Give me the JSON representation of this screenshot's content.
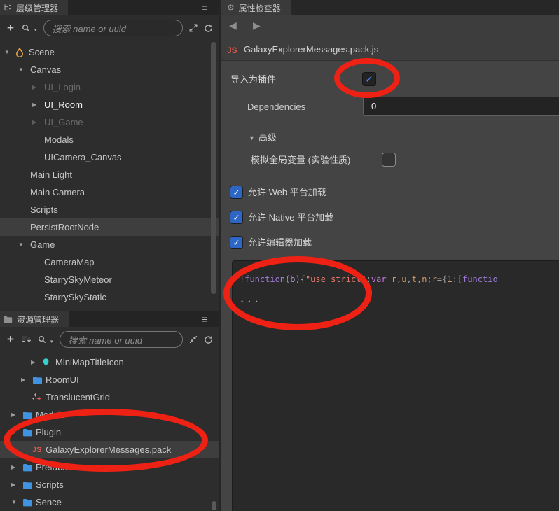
{
  "colors": {
    "annotation_red": "#ed2215",
    "accent_blue": "#2d66c5",
    "folder_blue": "#3f93e0",
    "js_red": "#e0584c",
    "prefab_teal": "#35d0ce",
    "scene_orange": "#e8a13e"
  },
  "icons": {
    "menu": "≡",
    "gear": "⚙",
    "back": "◀",
    "forward": "▶",
    "plus": "+",
    "check": "✓",
    "section_open": "▼",
    "search_caret": "▾"
  },
  "hierarchy_panel": {
    "tab_label": "层级管理器",
    "search_placeholder": "搜索 name or uuid",
    "tree": [
      {
        "label": "Scene",
        "depth": 0,
        "arrow": "open",
        "icon": "scene"
      },
      {
        "label": "Canvas",
        "depth": 1,
        "arrow": "open"
      },
      {
        "label": "UI_Login",
        "depth": 2,
        "arrow": "closed",
        "state": "dim"
      },
      {
        "label": "UI_Room",
        "depth": 2,
        "arrow": "closed",
        "state": "bright"
      },
      {
        "label": "UI_Game",
        "depth": 2,
        "arrow": "closed",
        "state": "dim"
      },
      {
        "label": "Modals",
        "depth": 2
      },
      {
        "label": "UICamera_Canvas",
        "depth": 2
      },
      {
        "label": "Main Light",
        "depth": 1
      },
      {
        "label": "Main Camera",
        "depth": 1
      },
      {
        "label": "Scripts",
        "depth": 1
      },
      {
        "label": "PersistRootNode",
        "depth": 1,
        "state": "selected"
      },
      {
        "label": "Game",
        "depth": 1,
        "arrow": "open"
      },
      {
        "label": "CameraMap",
        "depth": 2
      },
      {
        "label": "StarrySkyMeteor",
        "depth": 2
      },
      {
        "label": "StarrySkyStatic",
        "depth": 2
      }
    ]
  },
  "assets_panel": {
    "tab_label": "资源管理器",
    "search_placeholder": "搜索 name or uuid",
    "tree": [
      {
        "label": "MiniMapTitleIcon",
        "depth": 3,
        "arrow": "closed",
        "icon": "prefab"
      },
      {
        "label": "RoomUI",
        "depth": 2,
        "arrow": "closed",
        "icon": "folder"
      },
      {
        "label": "TranslucentGrid",
        "depth": 2,
        "icon": "sparkle"
      },
      {
        "label": "Models",
        "depth": 1,
        "arrow": "closed",
        "icon": "folder"
      },
      {
        "label": "Plugin",
        "depth": 1,
        "arrow": "open",
        "icon": "folder"
      },
      {
        "label": "GalaxyExplorerMessages.pack",
        "depth": 2,
        "icon": "js",
        "state": "selected"
      },
      {
        "label": "Prefabs",
        "depth": 1,
        "arrow": "closed",
        "icon": "folder"
      },
      {
        "label": "Scripts",
        "depth": 1,
        "arrow": "closed",
        "icon": "folder"
      },
      {
        "label": "Sence",
        "depth": 1,
        "arrow": "open",
        "icon": "folder"
      }
    ]
  },
  "inspector": {
    "tab_label": "属性检查器",
    "js_badge": "JS",
    "file_title": "GalaxyExplorerMessages.pack.js",
    "properties": {
      "import_as_plugin_label": "导入为插件",
      "dependencies_label": "Dependencies",
      "dependencies_value": "0",
      "advanced_label": "高级",
      "simulate_globals_label": "模拟全局变量 (实验性质)",
      "allow_web_label": "允许 Web 平台加载",
      "allow_native_label": "允许 Native 平台加载",
      "allow_editor_label": "允许编辑器加载"
    },
    "checkbox_states": {
      "import_as_plugin": true,
      "simulate_globals": false,
      "allow_web": true,
      "allow_native": true,
      "allow_editor": true
    },
    "code_preview": {
      "ellipsis_line": "...",
      "tokens": [
        {
          "text": "!",
          "color": "#e06c6c"
        },
        {
          "text": "function",
          "color": "#9d7bd8"
        },
        {
          "text": "(b)",
          "color": "#b48fd9"
        },
        {
          "text": "{",
          "color": "#9aa0a8"
        },
        {
          "text": "\"use strict\"",
          "color": "#e8796c"
        },
        {
          "text": ";",
          "color": "#9aa0a8"
        },
        {
          "text": "var",
          "color": "#c678dd"
        },
        {
          "text": " ",
          "color": "#9aa0a8"
        },
        {
          "text": "r",
          "color": "#d19a66"
        },
        {
          "text": ",",
          "color": "#9aa0a8"
        },
        {
          "text": "u",
          "color": "#d19a66"
        },
        {
          "text": ",",
          "color": "#9aa0a8"
        },
        {
          "text": "t",
          "color": "#d19a66"
        },
        {
          "text": ",",
          "color": "#9aa0a8"
        },
        {
          "text": "n",
          "color": "#d19a66"
        },
        {
          "text": ";",
          "color": "#9aa0a8"
        },
        {
          "text": "r",
          "color": "#d19a66"
        },
        {
          "text": "=",
          "color": "#9aa0a8"
        },
        {
          "text": "{",
          "color": "#9aa0a8"
        },
        {
          "text": "1",
          "color": "#d19a66"
        },
        {
          "text": ":",
          "color": "#9aa0a8"
        },
        {
          "text": "[",
          "color": "#9aa0a8"
        },
        {
          "text": "functio",
          "color": "#9d7bd8"
        }
      ]
    }
  }
}
